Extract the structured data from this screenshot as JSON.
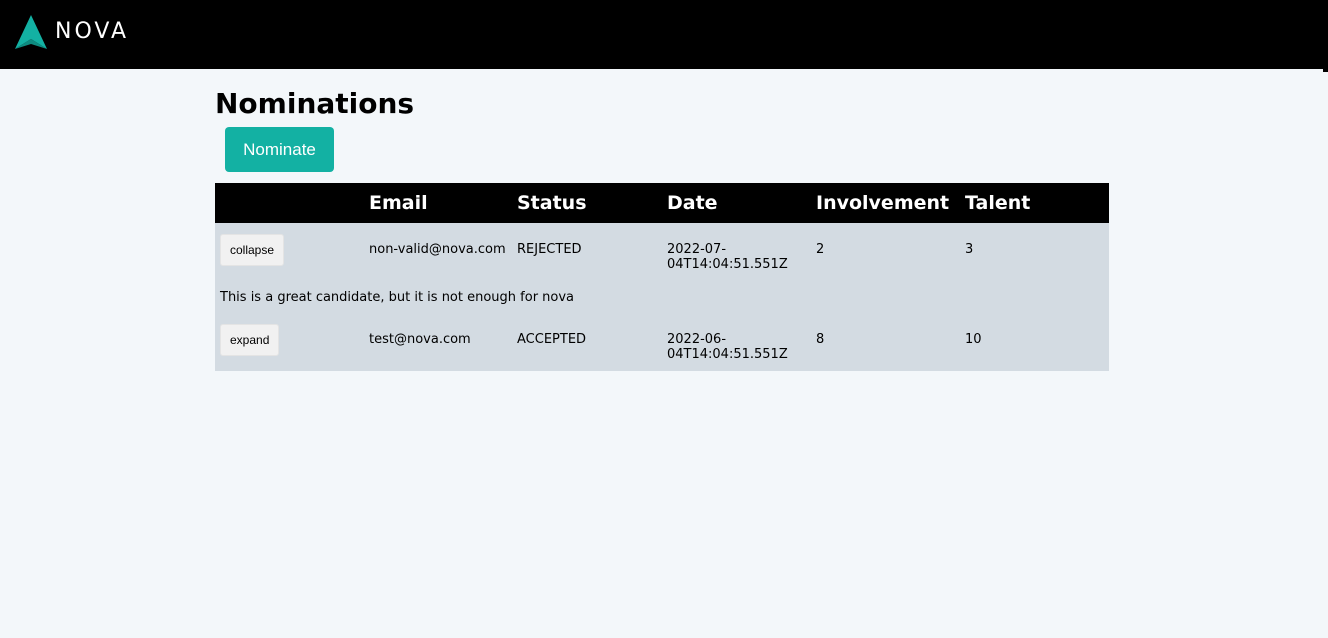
{
  "header": {
    "brand": "NOVA",
    "logo_icon": "nova-a-logo-icon",
    "background": "#000000",
    "accent": "#13b1a3"
  },
  "page": {
    "title": "Nominations",
    "nominate_label": "Nominate"
  },
  "table": {
    "columns": [
      "",
      "Email",
      "Status",
      "Date",
      "Involvement",
      "Talent"
    ],
    "rows": [
      {
        "toggle_label": "collapse",
        "email": "non-valid@nova.com",
        "status": "REJECTED",
        "date_line1": "2022-07-",
        "date_line2": "04T14:04:51.551Z",
        "involvement": "2",
        "talent": "3",
        "detail": "This is a great candidate, but it is not enough for nova"
      },
      {
        "toggle_label": "expand",
        "email": "test@nova.com",
        "status": "ACCEPTED",
        "date_line1": "2022-06-",
        "date_line2": "04T14:04:51.551Z",
        "involvement": "8",
        "talent": "10"
      }
    ]
  }
}
